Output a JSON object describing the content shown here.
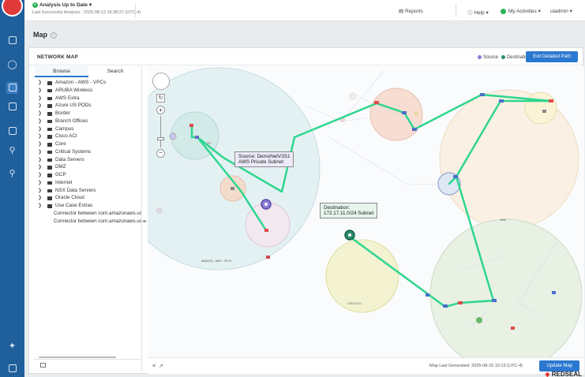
{
  "topbar": {
    "analysis_status": "Analysis Up to Date",
    "analysis_sub": "Last Successful Analysis : 2025-08-12 18:38:37 (UTC-4)",
    "reports": "Reports",
    "help": "Help",
    "activities": "My Activities",
    "user": "uiadmin"
  },
  "page": {
    "title": "Map"
  },
  "card": {
    "title": "NETWORK MAP",
    "legend_source": "Source",
    "legend_destination": "Destination",
    "exit_button": "Exit Detailed Path"
  },
  "tabs": {
    "browse": "Browse",
    "search": "Search"
  },
  "tree": [
    "Amazon - AWS - VPCs",
    "ARUBA Wireless",
    "AWS Extra",
    "Azure US PODs",
    "Border",
    "Branch Offices",
    "Campus",
    "Cisco ACI",
    "Core",
    "Critical Systems",
    "Data Servers",
    "DMZ",
    "GCP",
    "Internet",
    "NSX Data Servers",
    "Oracle Cloud",
    "Use Case Extras"
  ],
  "connectors": [
    "Connector between com.amazonaws.us-w",
    "Connector between com.amazonaws.us-w"
  ],
  "map": {
    "source_tooltip_line1": "Source: DemoNetV3S1",
    "source_tooltip_line2": "AWS Private Subnet",
    "dest_tooltip_line1": "Destination:",
    "dest_tooltip_line2": "172.17.11.0/24 Subnet",
    "zone_aws": "AMAZON - AWS - VPCS",
    "zone_cisco": "CISCO ACI",
    "zone_dmz": "DMZ"
  },
  "footer": {
    "generated": "Map Last Generated: 2025-08-15 10:13 (UTC-4)",
    "update_button": "Update Map"
  },
  "brand": {
    "name": "REDSEAL"
  },
  "colors": {
    "sidebar": "#1f5f9c",
    "accent": "#2b78d0",
    "path": "#2ed68f",
    "source": "#8b7bd8",
    "destination": "#2a8a6a"
  }
}
